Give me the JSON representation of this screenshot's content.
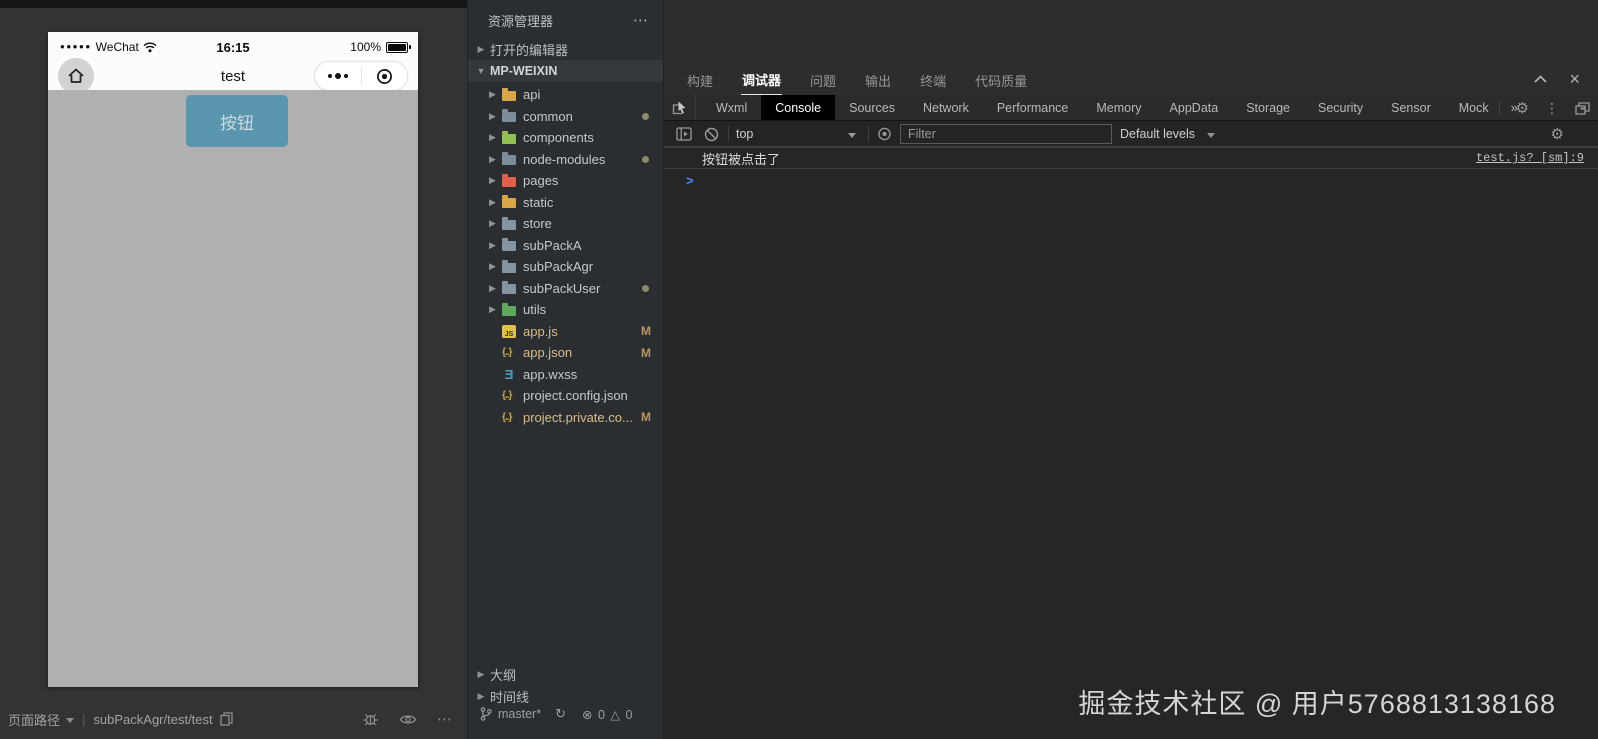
{
  "colors": {
    "button_accent": "#5a96ad",
    "prompt_blue": "#4a8de8",
    "modified_text": "#d8bd8c",
    "modified_badge": "#b79766",
    "marker_dot": "#8b8b6e"
  },
  "icons": {
    "more_horizontal": "⋯",
    "overflow_chevrons": "»",
    "gear": "⚙",
    "kebab": "⋮",
    "sync": "↻",
    "error": "⊗",
    "warning": "△",
    "close": "×"
  },
  "simulator": {
    "status": {
      "carrier_dots": "●●●●●",
      "carrier": "WeChat",
      "time": "16:15",
      "battery_percent": "100%"
    },
    "nav": {
      "title": "test"
    },
    "button_label": "按钮",
    "footer": {
      "page_path_label": "页面路径",
      "page_path_value": "subPackAgr/test/test"
    }
  },
  "explorer": {
    "title": "资源管理器",
    "open_editors_label": "打开的编辑器",
    "project_label": "MP-WEIXIN",
    "outline_label": "大纲",
    "timeline_label": "时间线",
    "tree": [
      {
        "label": "api",
        "kind": "folder",
        "color": "#d9a648",
        "marker": false,
        "badge": ""
      },
      {
        "label": "common",
        "kind": "folder",
        "color": "#7d8c99",
        "marker": true,
        "badge": ""
      },
      {
        "label": "components",
        "kind": "folder",
        "color": "#95c153",
        "marker": false,
        "badge": ""
      },
      {
        "label": "node-modules",
        "kind": "folder",
        "color": "#7d8c99",
        "marker": true,
        "badge": ""
      },
      {
        "label": "pages",
        "kind": "folder",
        "color": "#e0604c",
        "marker": false,
        "badge": ""
      },
      {
        "label": "static",
        "kind": "folder",
        "color": "#d9a648",
        "marker": false,
        "badge": ""
      },
      {
        "label": "store",
        "kind": "folder",
        "color": "#8494a0",
        "marker": false,
        "badge": ""
      },
      {
        "label": "subPackA",
        "kind": "folder",
        "color": "#8494a0",
        "marker": false,
        "badge": ""
      },
      {
        "label": "subPackAgr",
        "kind": "folder",
        "color": "#8494a0",
        "marker": false,
        "badge": ""
      },
      {
        "label": "subPackUser",
        "kind": "folder",
        "color": "#8494a0",
        "marker": true,
        "badge": ""
      },
      {
        "label": "utils",
        "kind": "folder",
        "color": "#5fa65f",
        "marker": false,
        "badge": ""
      },
      {
        "label": "app.js",
        "kind": "js",
        "color": "#e3c04d",
        "marker": false,
        "badge": "M"
      },
      {
        "label": "app.json",
        "kind": "json",
        "color": "#c9a84c",
        "marker": false,
        "badge": "M"
      },
      {
        "label": "app.wxss",
        "kind": "wxss",
        "color": "#519aba",
        "marker": false,
        "badge": ""
      },
      {
        "label": "project.config.json",
        "kind": "json",
        "color": "#c9a84c",
        "marker": false,
        "badge": ""
      },
      {
        "label": "project.private.co...",
        "kind": "json",
        "color": "#c9a84c",
        "marker": false,
        "badge": "M"
      }
    ],
    "git": {
      "branch": "master*",
      "error_count": "0",
      "warning_count": "0"
    }
  },
  "debugger": {
    "panel_tabs": [
      {
        "label": "构建",
        "active": false
      },
      {
        "label": "调试器",
        "active": true
      },
      {
        "label": "问题",
        "active": false
      },
      {
        "label": "输出",
        "active": false
      },
      {
        "label": "终端",
        "active": false
      },
      {
        "label": "代码质量",
        "active": false
      }
    ],
    "devtools_tabs": [
      {
        "label": "Wxml",
        "active": false
      },
      {
        "label": "Console",
        "active": true
      },
      {
        "label": "Sources",
        "active": false
      },
      {
        "label": "Network",
        "active": false
      },
      {
        "label": "Performance",
        "active": false
      },
      {
        "label": "Memory",
        "active": false
      },
      {
        "label": "AppData",
        "active": false
      },
      {
        "label": "Storage",
        "active": false
      },
      {
        "label": "Security",
        "active": false
      },
      {
        "label": "Sensor",
        "active": false
      },
      {
        "label": "Mock",
        "active": false
      }
    ],
    "toolbar": {
      "context_selector": "top",
      "filter_placeholder": "Filter",
      "levels_label": "Default levels"
    },
    "console": {
      "message": "按钮被点击了",
      "source_link": "test.js? [sm]:9",
      "prompt": ">"
    }
  },
  "watermark": "掘金技术社区 @ 用户5768813138168"
}
